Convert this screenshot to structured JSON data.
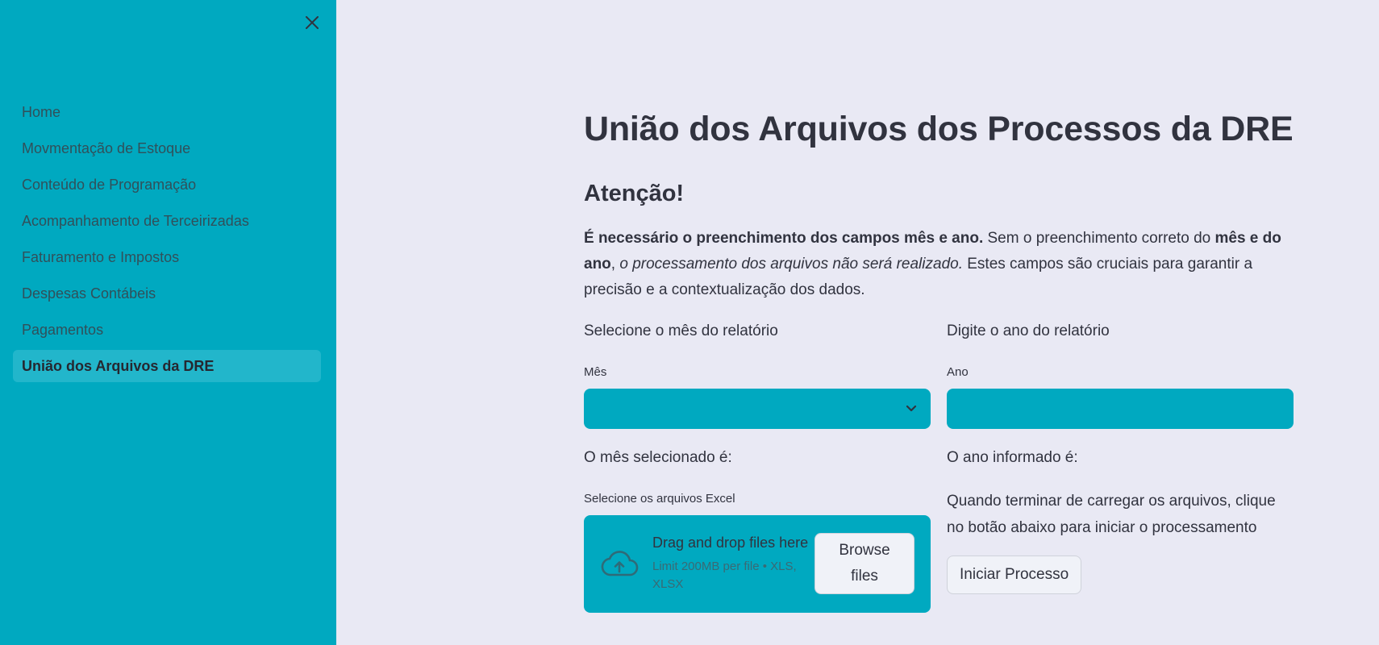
{
  "sidebar": {
    "close_icon": "close-icon",
    "items": [
      {
        "label": "Home",
        "active": false
      },
      {
        "label": "Movmentação de Estoque",
        "active": false
      },
      {
        "label": "Conteúdo de Programação",
        "active": false
      },
      {
        "label": "Acompanhamento de Terceirizadas",
        "active": false
      },
      {
        "label": "Faturamento e Impostos",
        "active": false
      },
      {
        "label": "Despesas Contábeis",
        "active": false
      },
      {
        "label": "Pagamentos",
        "active": false
      },
      {
        "label": "União dos Arquivos da DRE",
        "active": true
      }
    ]
  },
  "main": {
    "title": "União dos Arquivos dos Processos da DRE",
    "subtitle": "Atenção!",
    "notice": {
      "bold_lead": "É necessário o preenchimento dos campos mês e ano.",
      "text_1": " Sem o preenchimento correto do ",
      "bold_mid": "mês e do ano",
      "text_2": ", ",
      "italic": "o processamento dos arquivos não será realizado.",
      "text_3": " Estes campos são cruciais para garantir a precisão e a contextualização dos dados."
    },
    "month": {
      "section_label": "Selecione o mês do relatório",
      "field_label": "Mês",
      "selected_value": "",
      "result_label": "O mês selecionado é:"
    },
    "year": {
      "section_label": "Digite o ano do relatório",
      "field_label": "Ano",
      "value": "",
      "result_label": "O ano informado é:"
    },
    "uploader": {
      "label": "Selecione os arquivos Excel",
      "drop_title": "Drag and drop files here",
      "limit_text": "Limit 200MB per file • XLS, XLSX",
      "browse_line1": "Browse",
      "browse_line2": "files",
      "icon": "cloud-upload-icon"
    },
    "process": {
      "instruction": "Quando terminar de carregar os arquivos, clique no botão abaixo para iniciar o processamento",
      "button_label": "Iniciar Processo"
    }
  },
  "colors": {
    "sidebar_bg": "#00a9c0",
    "page_bg": "#e9e9f4",
    "input_bg": "#00a9c0",
    "text": "#31333f"
  }
}
